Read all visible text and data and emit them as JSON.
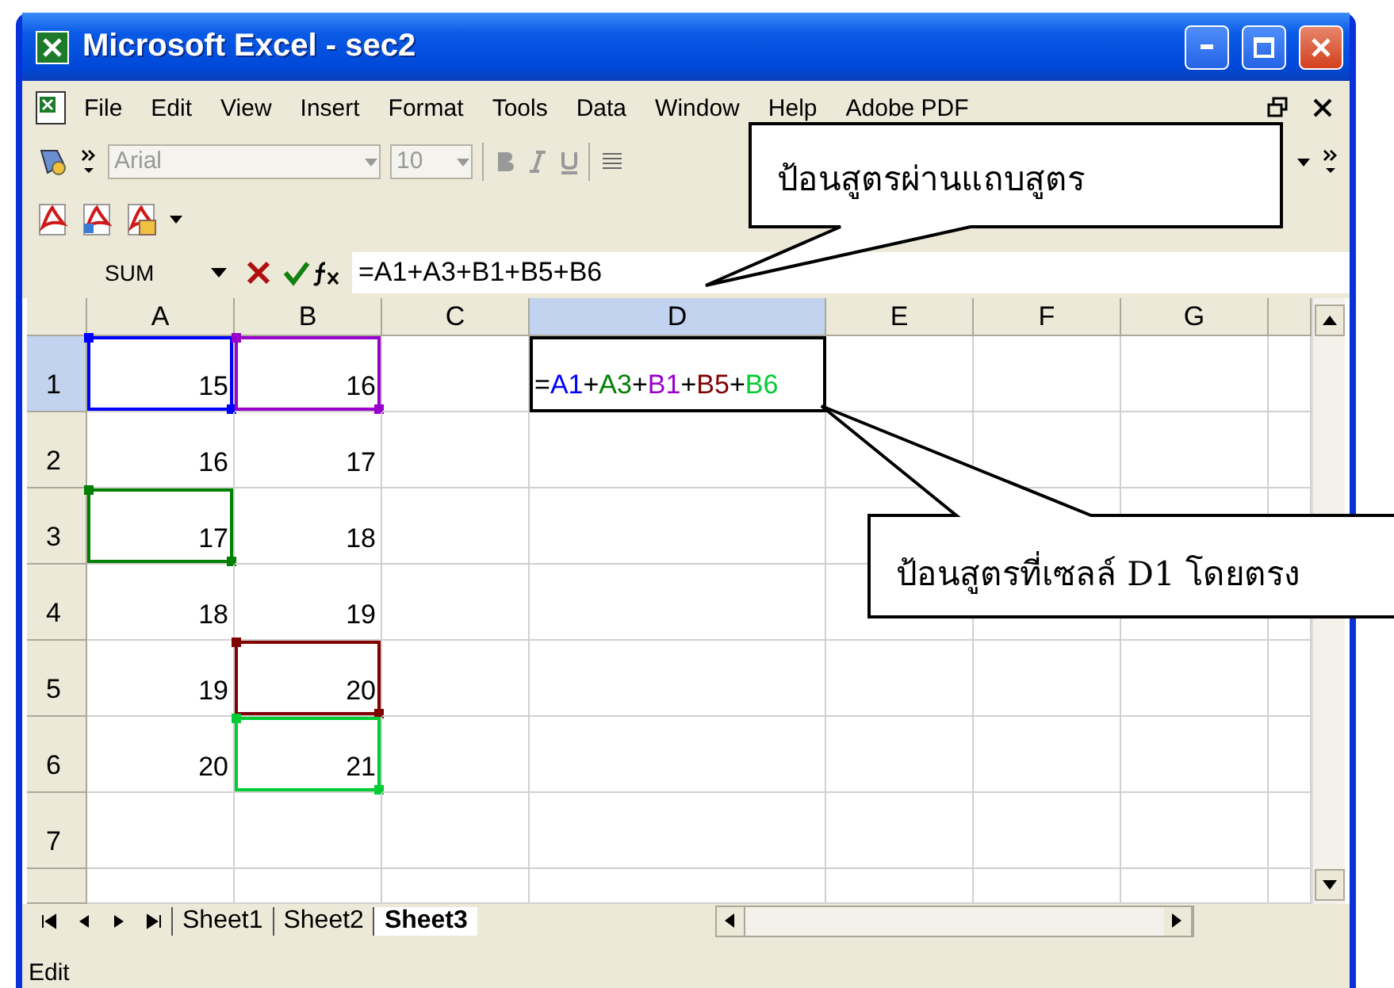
{
  "window": {
    "title": "Microsoft Excel - sec2"
  },
  "menu": [
    {
      "label": "File"
    },
    {
      "label": "Edit"
    },
    {
      "label": "View"
    },
    {
      "label": "Insert"
    },
    {
      "label": "Format"
    },
    {
      "label": "Tools"
    },
    {
      "label": "Data"
    },
    {
      "label": "Window"
    },
    {
      "label": "Help"
    },
    {
      "label": "Adobe PDF"
    }
  ],
  "toolbar": {
    "font": "Arial",
    "size": "10"
  },
  "formula_bar": {
    "name_box": "SUM",
    "formula": "=A1+A3+B1+B5+B6"
  },
  "columns": [
    {
      "label": "A",
      "selected": false
    },
    {
      "label": "B",
      "selected": false
    },
    {
      "label": "C",
      "selected": false
    },
    {
      "label": "D",
      "selected": true
    },
    {
      "label": "E",
      "selected": false
    },
    {
      "label": "F",
      "selected": false
    },
    {
      "label": "G",
      "selected": false
    }
  ],
  "rows": [
    {
      "header": "1",
      "selected": true,
      "a": {
        "value": "15",
        "color": "#0000ff",
        "selected": false
      },
      "b": {
        "value": "16",
        "color": "#9900cc",
        "selected": false
      },
      "d": {
        "selected": true,
        "parts": [
          {
            "text": "=",
            "color": "#000000"
          },
          {
            "text": "A1",
            "color": "#0000ff"
          },
          {
            "text": "+",
            "color": "#000000"
          },
          {
            "text": "A3",
            "color": "#008000"
          },
          {
            "text": "+",
            "color": "#000000"
          },
          {
            "text": "B1",
            "color": "#9900cc"
          },
          {
            "text": "+",
            "color": "#000000"
          },
          {
            "text": "B5",
            "color": "#800000"
          },
          {
            "text": "+",
            "color": "#000000"
          },
          {
            "text": "B6",
            "color": "#00cc33"
          }
        ]
      }
    },
    {
      "header": "2",
      "selected": false,
      "a": {
        "value": "16",
        "selected": false
      },
      "b": {
        "value": "17",
        "selected": false
      }
    },
    {
      "header": "3",
      "selected": false,
      "a": {
        "value": "17",
        "color": "#008000",
        "selected": false
      },
      "b": {
        "value": "18",
        "selected": false
      }
    },
    {
      "header": "4",
      "selected": false,
      "a": {
        "value": "18",
        "selected": false
      },
      "b": {
        "value": "19",
        "selected": false
      }
    },
    {
      "header": "5",
      "selected": false,
      "a": {
        "value": "19",
        "selected": false
      },
      "b": {
        "value": "20",
        "color": "#800000",
        "selected": false
      }
    },
    {
      "header": "6",
      "selected": false,
      "a": {
        "value": "20",
        "selected": false
      },
      "b": {
        "value": "21",
        "color": "#00cc33",
        "selected": false
      }
    },
    {
      "header": "7",
      "selected": false
    }
  ],
  "sheet_tabs": [
    {
      "label": "Sheet1",
      "selected": false
    },
    {
      "label": "Sheet2",
      "selected": false
    },
    {
      "label": "Sheet3",
      "selected": true
    }
  ],
  "status_bar": {
    "mode": "Edit"
  },
  "callouts": [
    {
      "text": "ป้อนสูตรผ่านแถบสูตร"
    },
    {
      "text": "ป้อนสูตรที่เซลล์ D1 โดยตรง"
    }
  ]
}
